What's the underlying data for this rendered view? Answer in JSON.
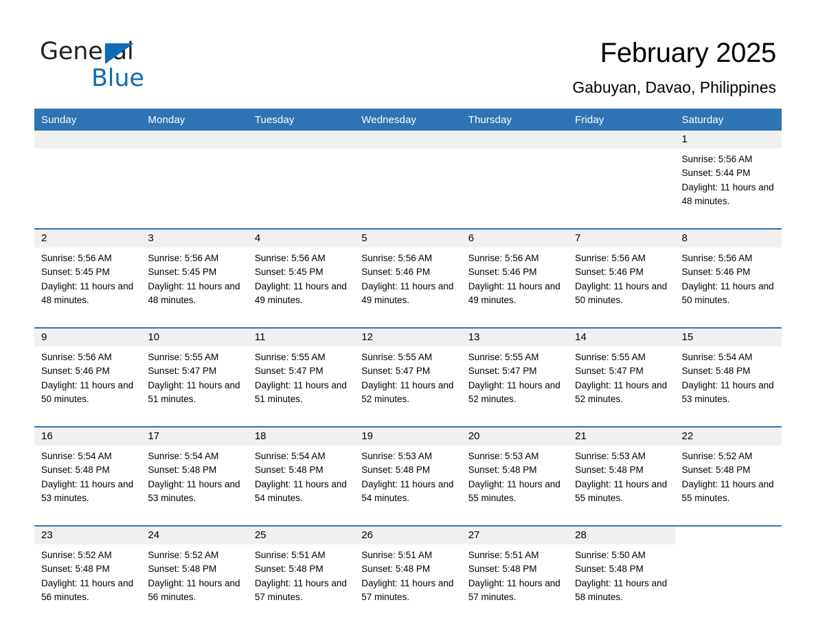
{
  "logo": {
    "word1": "General",
    "word2": "Blue",
    "triangle_color": "#0c6cb5",
    "text_color": "#231f20"
  },
  "header": {
    "month_title": "February 2025",
    "location": "Gabuyan, Davao, Philippines",
    "accent_color": "#2e74b5"
  },
  "weekday_headers": [
    "Sunday",
    "Monday",
    "Tuesday",
    "Wednesday",
    "Thursday",
    "Friday",
    "Saturday"
  ],
  "weeks": [
    [
      {
        "day": "",
        "empty": true
      },
      {
        "day": "",
        "empty": true
      },
      {
        "day": "",
        "empty": true
      },
      {
        "day": "",
        "empty": true
      },
      {
        "day": "",
        "empty": true
      },
      {
        "day": "",
        "empty": true
      },
      {
        "day": "1",
        "sunrise": "Sunrise: 5:56 AM",
        "sunset": "Sunset: 5:44 PM",
        "daylight": "Daylight: 11 hours and 48 minutes."
      }
    ],
    [
      {
        "day": "2",
        "sunrise": "Sunrise: 5:56 AM",
        "sunset": "Sunset: 5:45 PM",
        "daylight": "Daylight: 11 hours and 48 minutes."
      },
      {
        "day": "3",
        "sunrise": "Sunrise: 5:56 AM",
        "sunset": "Sunset: 5:45 PM",
        "daylight": "Daylight: 11 hours and 48 minutes."
      },
      {
        "day": "4",
        "sunrise": "Sunrise: 5:56 AM",
        "sunset": "Sunset: 5:45 PM",
        "daylight": "Daylight: 11 hours and 49 minutes."
      },
      {
        "day": "5",
        "sunrise": "Sunrise: 5:56 AM",
        "sunset": "Sunset: 5:46 PM",
        "daylight": "Daylight: 11 hours and 49 minutes."
      },
      {
        "day": "6",
        "sunrise": "Sunrise: 5:56 AM",
        "sunset": "Sunset: 5:46 PM",
        "daylight": "Daylight: 11 hours and 49 minutes."
      },
      {
        "day": "7",
        "sunrise": "Sunrise: 5:56 AM",
        "sunset": "Sunset: 5:46 PM",
        "daylight": "Daylight: 11 hours and 50 minutes."
      },
      {
        "day": "8",
        "sunrise": "Sunrise: 5:56 AM",
        "sunset": "Sunset: 5:46 PM",
        "daylight": "Daylight: 11 hours and 50 minutes."
      }
    ],
    [
      {
        "day": "9",
        "sunrise": "Sunrise: 5:56 AM",
        "sunset": "Sunset: 5:46 PM",
        "daylight": "Daylight: 11 hours and 50 minutes."
      },
      {
        "day": "10",
        "sunrise": "Sunrise: 5:55 AM",
        "sunset": "Sunset: 5:47 PM",
        "daylight": "Daylight: 11 hours and 51 minutes."
      },
      {
        "day": "11",
        "sunrise": "Sunrise: 5:55 AM",
        "sunset": "Sunset: 5:47 PM",
        "daylight": "Daylight: 11 hours and 51 minutes."
      },
      {
        "day": "12",
        "sunrise": "Sunrise: 5:55 AM",
        "sunset": "Sunset: 5:47 PM",
        "daylight": "Daylight: 11 hours and 52 minutes."
      },
      {
        "day": "13",
        "sunrise": "Sunrise: 5:55 AM",
        "sunset": "Sunset: 5:47 PM",
        "daylight": "Daylight: 11 hours and 52 minutes."
      },
      {
        "day": "14",
        "sunrise": "Sunrise: 5:55 AM",
        "sunset": "Sunset: 5:47 PM",
        "daylight": "Daylight: 11 hours and 52 minutes."
      },
      {
        "day": "15",
        "sunrise": "Sunrise: 5:54 AM",
        "sunset": "Sunset: 5:48 PM",
        "daylight": "Daylight: 11 hours and 53 minutes."
      }
    ],
    [
      {
        "day": "16",
        "sunrise": "Sunrise: 5:54 AM",
        "sunset": "Sunset: 5:48 PM",
        "daylight": "Daylight: 11 hours and 53 minutes."
      },
      {
        "day": "17",
        "sunrise": "Sunrise: 5:54 AM",
        "sunset": "Sunset: 5:48 PM",
        "daylight": "Daylight: 11 hours and 53 minutes."
      },
      {
        "day": "18",
        "sunrise": "Sunrise: 5:54 AM",
        "sunset": "Sunset: 5:48 PM",
        "daylight": "Daylight: 11 hours and 54 minutes."
      },
      {
        "day": "19",
        "sunrise": "Sunrise: 5:53 AM",
        "sunset": "Sunset: 5:48 PM",
        "daylight": "Daylight: 11 hours and 54 minutes."
      },
      {
        "day": "20",
        "sunrise": "Sunrise: 5:53 AM",
        "sunset": "Sunset: 5:48 PM",
        "daylight": "Daylight: 11 hours and 55 minutes."
      },
      {
        "day": "21",
        "sunrise": "Sunrise: 5:53 AM",
        "sunset": "Sunset: 5:48 PM",
        "daylight": "Daylight: 11 hours and 55 minutes."
      },
      {
        "day": "22",
        "sunrise": "Sunrise: 5:52 AM",
        "sunset": "Sunset: 5:48 PM",
        "daylight": "Daylight: 11 hours and 55 minutes."
      }
    ],
    [
      {
        "day": "23",
        "sunrise": "Sunrise: 5:52 AM",
        "sunset": "Sunset: 5:48 PM",
        "daylight": "Daylight: 11 hours and 56 minutes."
      },
      {
        "day": "24",
        "sunrise": "Sunrise: 5:52 AM",
        "sunset": "Sunset: 5:48 PM",
        "daylight": "Daylight: 11 hours and 56 minutes."
      },
      {
        "day": "25",
        "sunrise": "Sunrise: 5:51 AM",
        "sunset": "Sunset: 5:48 PM",
        "daylight": "Daylight: 11 hours and 57 minutes."
      },
      {
        "day": "26",
        "sunrise": "Sunrise: 5:51 AM",
        "sunset": "Sunset: 5:48 PM",
        "daylight": "Daylight: 11 hours and 57 minutes."
      },
      {
        "day": "27",
        "sunrise": "Sunrise: 5:51 AM",
        "sunset": "Sunset: 5:48 PM",
        "daylight": "Daylight: 11 hours and 57 minutes."
      },
      {
        "day": "28",
        "sunrise": "Sunrise: 5:50 AM",
        "sunset": "Sunset: 5:48 PM",
        "daylight": "Daylight: 11 hours and 58 minutes."
      },
      {
        "day": "",
        "blank": true
      }
    ]
  ]
}
